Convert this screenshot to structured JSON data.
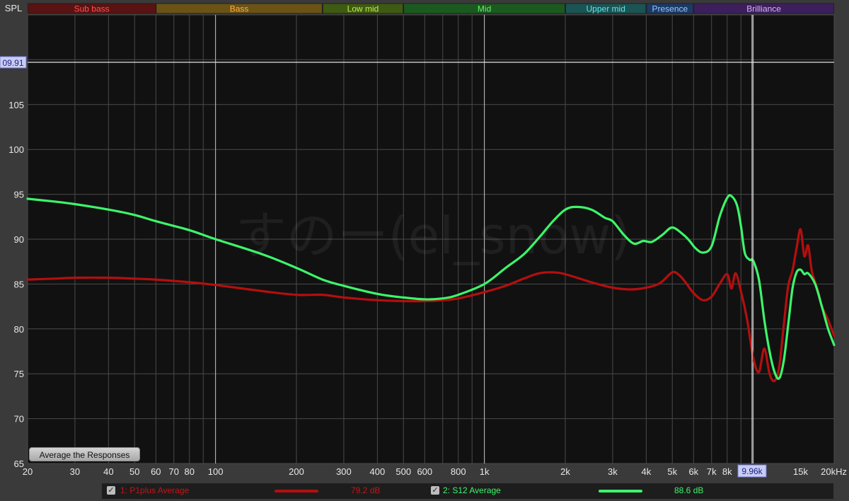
{
  "colors": {
    "background": "#3a3a3a",
    "plot_background": "#111111",
    "series_1": "#b40f0f",
    "series_2": "#3df56b",
    "cursor_label_bg": "#c9cdf2"
  },
  "frequency_bands": [
    {
      "label": "Sub bass",
      "from": 20,
      "to": 60,
      "bg": "#5a1212",
      "fg": "#ff5252"
    },
    {
      "label": "Bass",
      "from": 60,
      "to": 250,
      "bg": "#6b5316",
      "fg": "#ffb03a"
    },
    {
      "label": "Low mid",
      "from": 250,
      "to": 500,
      "bg": "#3f5a12",
      "fg": "#b9f04a"
    },
    {
      "label": "Mid",
      "from": 500,
      "to": 2000,
      "bg": "#1b5a1f",
      "fg": "#62ee6a"
    },
    {
      "label": "Upper mid",
      "from": 2000,
      "to": 4000,
      "bg": "#1b5454",
      "fg": "#5ce6e6"
    },
    {
      "label": "Presence",
      "from": 4000,
      "to": 6000,
      "bg": "#1b3a66",
      "fg": "#9cc6ff"
    },
    {
      "label": "Brilliance",
      "from": 6000,
      "to": 20000,
      "bg": "#3c1f5c",
      "fg": "#d6b3ff"
    }
  ],
  "axes": {
    "y_title": "SPL",
    "y_ticks": [
      "105",
      "100",
      "95",
      "90",
      "85",
      "80",
      "75",
      "70",
      "65"
    ],
    "x_ticks": [
      "20",
      "30",
      "40",
      "50",
      "60",
      "70",
      "80",
      "100",
      "200",
      "300",
      "400",
      "500",
      "600",
      "800",
      "1k",
      "2k",
      "3k",
      "4k",
      "5k",
      "6k",
      "7k",
      "8k",
      "15k",
      "20kHz"
    ],
    "cursor_y_label": "09.91",
    "cursor_x_label": "9.96k"
  },
  "watermark": "すのー(el_snow)",
  "controls": {
    "average_button": "Average the Responses"
  },
  "legend": [
    {
      "check": "✓",
      "label": "1: P1plus Average",
      "value": "79.2 dB"
    },
    {
      "check": "✓",
      "label": "2: S12 Average",
      "value": "88.6 dB"
    }
  ],
  "chart_data": {
    "type": "line",
    "x_scale": "log",
    "xlim": [
      20,
      20000
    ],
    "ylim": [
      65,
      115
    ],
    "ylabel": "SPL",
    "grid": true,
    "cursor": {
      "x": 9960,
      "y": 109.91
    },
    "series": [
      {
        "name": "1: P1plus Average",
        "x": [
          20,
          25,
          30,
          40,
          50,
          60,
          80,
          100,
          150,
          200,
          250,
          300,
          400,
          500,
          600,
          700,
          800,
          1000,
          1200,
          1400,
          1600,
          1800,
          2000,
          2500,
          3000,
          3500,
          4000,
          4500,
          5000,
          5300,
          5600,
          6000,
          6500,
          7000,
          7500,
          8000,
          8300,
          8600,
          9000,
          9500,
          10000,
          10500,
          11000,
          11500,
          12000,
          12500,
          13000,
          13500,
          14000,
          14500,
          15000,
          15500,
          16000,
          16500,
          17000,
          17500,
          18000,
          19000,
          20000
        ],
        "y": [
          85.5,
          85.6,
          85.7,
          85.7,
          85.6,
          85.5,
          85.2,
          84.9,
          84.2,
          83.8,
          83.8,
          83.5,
          83.2,
          83.1,
          83.1,
          83.2,
          83.4,
          84.1,
          84.8,
          85.6,
          86.2,
          86.3,
          86.1,
          85.2,
          84.6,
          84.4,
          84.6,
          85.1,
          86.3,
          86.0,
          85.2,
          84.0,
          83.2,
          83.6,
          85.0,
          86.1,
          84.5,
          86.2,
          84.2,
          81.0,
          76.8,
          75.2,
          77.8,
          75.0,
          74.2,
          75.8,
          80.5,
          84.8,
          86.5,
          89.0,
          91.1,
          88.1,
          89.3,
          86.5,
          85.2,
          84.0,
          82.5,
          81.0,
          79.2
        ]
      },
      {
        "name": "2: S12 Average",
        "x": [
          20,
          25,
          30,
          40,
          50,
          60,
          80,
          100,
          150,
          200,
          250,
          300,
          400,
          500,
          600,
          700,
          800,
          1000,
          1200,
          1400,
          1600,
          1800,
          2000,
          2200,
          2500,
          2800,
          3000,
          3300,
          3600,
          3900,
          4200,
          4600,
          5000,
          5500,
          5800,
          6100,
          6500,
          7000,
          7500,
          8000,
          8300,
          8700,
          9000,
          9300,
          9700,
          10000,
          10500,
          11000,
          11500,
          12000,
          12500,
          13000,
          13500,
          14000,
          14500,
          15000,
          15500,
          16000,
          17000,
          18000,
          19000,
          20000
        ],
        "y": [
          94.5,
          94.2,
          93.9,
          93.3,
          92.7,
          92.0,
          91.0,
          90.0,
          88.3,
          86.8,
          85.5,
          84.8,
          83.9,
          83.5,
          83.3,
          83.4,
          83.8,
          85.0,
          86.8,
          88.3,
          90.2,
          92.0,
          93.3,
          93.6,
          93.3,
          92.4,
          92.0,
          90.5,
          89.5,
          89.8,
          89.7,
          90.5,
          91.3,
          90.5,
          89.8,
          89.0,
          88.5,
          89.2,
          92.5,
          94.6,
          94.8,
          93.8,
          91.5,
          88.5,
          87.7,
          87.6,
          85.5,
          81.0,
          77.5,
          75.2,
          74.5,
          76.5,
          80.5,
          84.5,
          86.3,
          86.6,
          86.1,
          86.2,
          85.0,
          82.5,
          80.0,
          78.2
        ]
      }
    ]
  }
}
